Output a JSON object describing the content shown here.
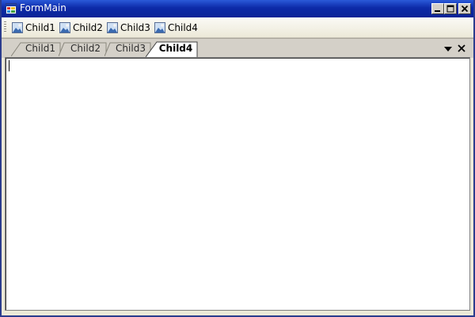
{
  "window": {
    "title": "FormMain",
    "icons": {
      "app": "app-window-icon",
      "minimize": "minimize-icon",
      "maximize": "maximize-icon",
      "close": "close-icon"
    }
  },
  "toolbar": {
    "buttons": [
      {
        "label": "Child1",
        "icon": "image-icon"
      },
      {
        "label": "Child2",
        "icon": "image-icon"
      },
      {
        "label": "Child3",
        "icon": "image-icon"
      },
      {
        "label": "Child4",
        "icon": "image-icon"
      }
    ]
  },
  "tabs": {
    "items": [
      {
        "label": "Child1",
        "active": false
      },
      {
        "label": "Child2",
        "active": false
      },
      {
        "label": "Child3",
        "active": false
      },
      {
        "label": "Child4",
        "active": true
      }
    ],
    "icons": {
      "menu": "dropdown-arrow-icon",
      "close": "close-tab-icon"
    }
  },
  "content": {
    "text": ""
  },
  "colors": {
    "titlebar": "#0d2aa8",
    "background": "#d4d0c8",
    "content": "#ffffff"
  }
}
